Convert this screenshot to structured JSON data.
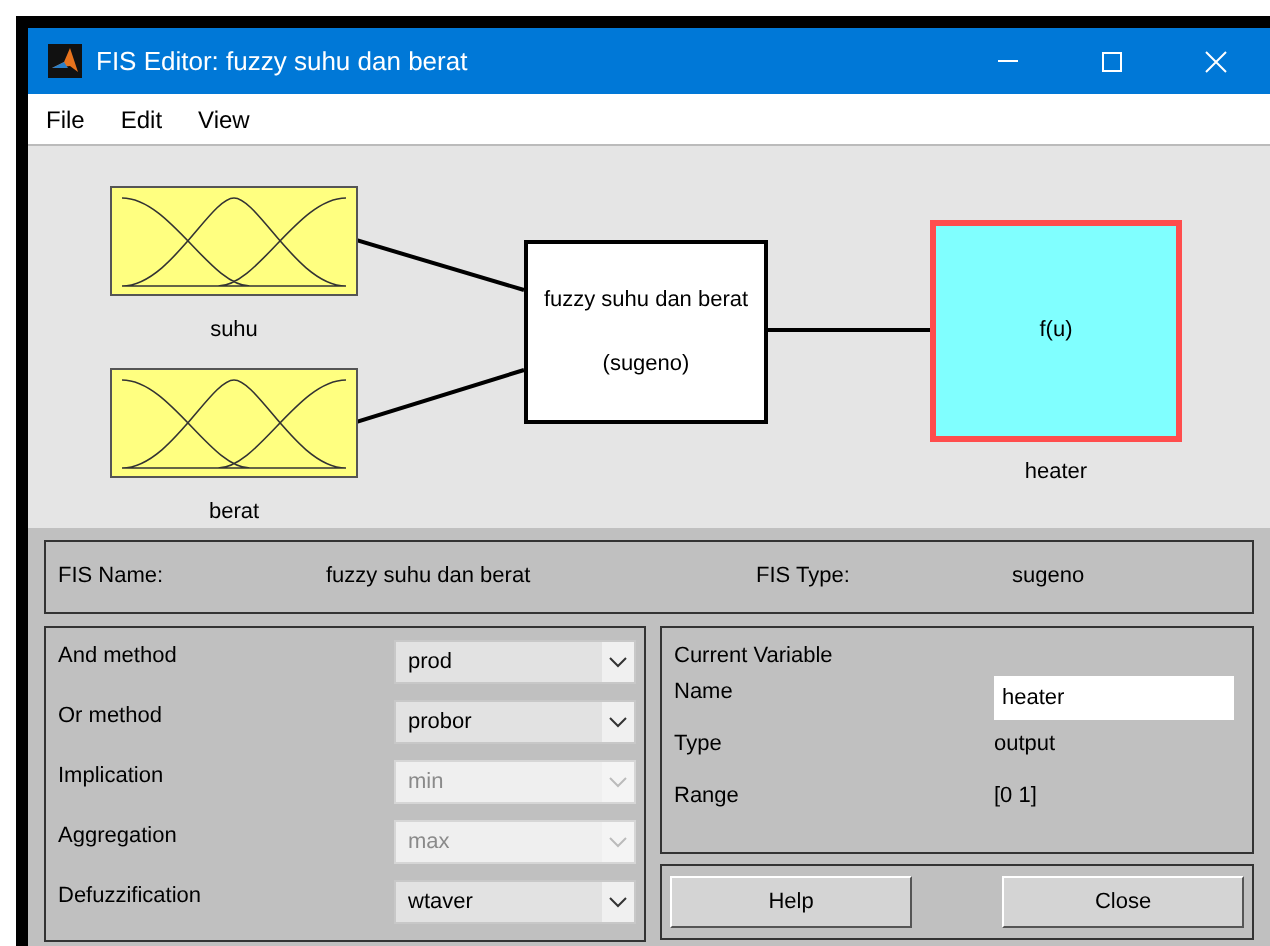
{
  "window": {
    "title": "FIS Editor: fuzzy suhu dan berat"
  },
  "menu": [
    {
      "label": "File"
    },
    {
      "label": "Edit"
    },
    {
      "label": "View"
    }
  ],
  "diagram": {
    "inputs": [
      {
        "name": "suhu"
      },
      {
        "name": "berat"
      }
    ],
    "system": {
      "name": "fuzzy suhu dan berat",
      "type": "(sugeno)"
    },
    "outputs": [
      {
        "name": "heater",
        "label": "f(u)",
        "selected": true
      }
    ]
  },
  "fis_info": {
    "name_label": "FIS Name:",
    "name": "fuzzy suhu dan berat",
    "type_label": "FIS Type:",
    "type": "sugeno"
  },
  "methods": [
    {
      "label": "And method",
      "value": "prod",
      "disabled": false
    },
    {
      "label": "Or method",
      "value": "probor",
      "disabled": false
    },
    {
      "label": "Implication",
      "value": "min",
      "disabled": true
    },
    {
      "label": "Aggregation",
      "value": "max",
      "disabled": true
    },
    {
      "label": "Defuzzification",
      "value": "wtaver",
      "disabled": false
    }
  ],
  "current_variable": {
    "title": "Current Variable",
    "fields": [
      {
        "label": "Name",
        "value": "heater",
        "kind": "input"
      },
      {
        "label": "Type",
        "value": "output",
        "kind": "text"
      },
      {
        "label": "Range",
        "value": "[0 1]",
        "kind": "text"
      }
    ]
  },
  "buttons": [
    "Help",
    "Close"
  ]
}
